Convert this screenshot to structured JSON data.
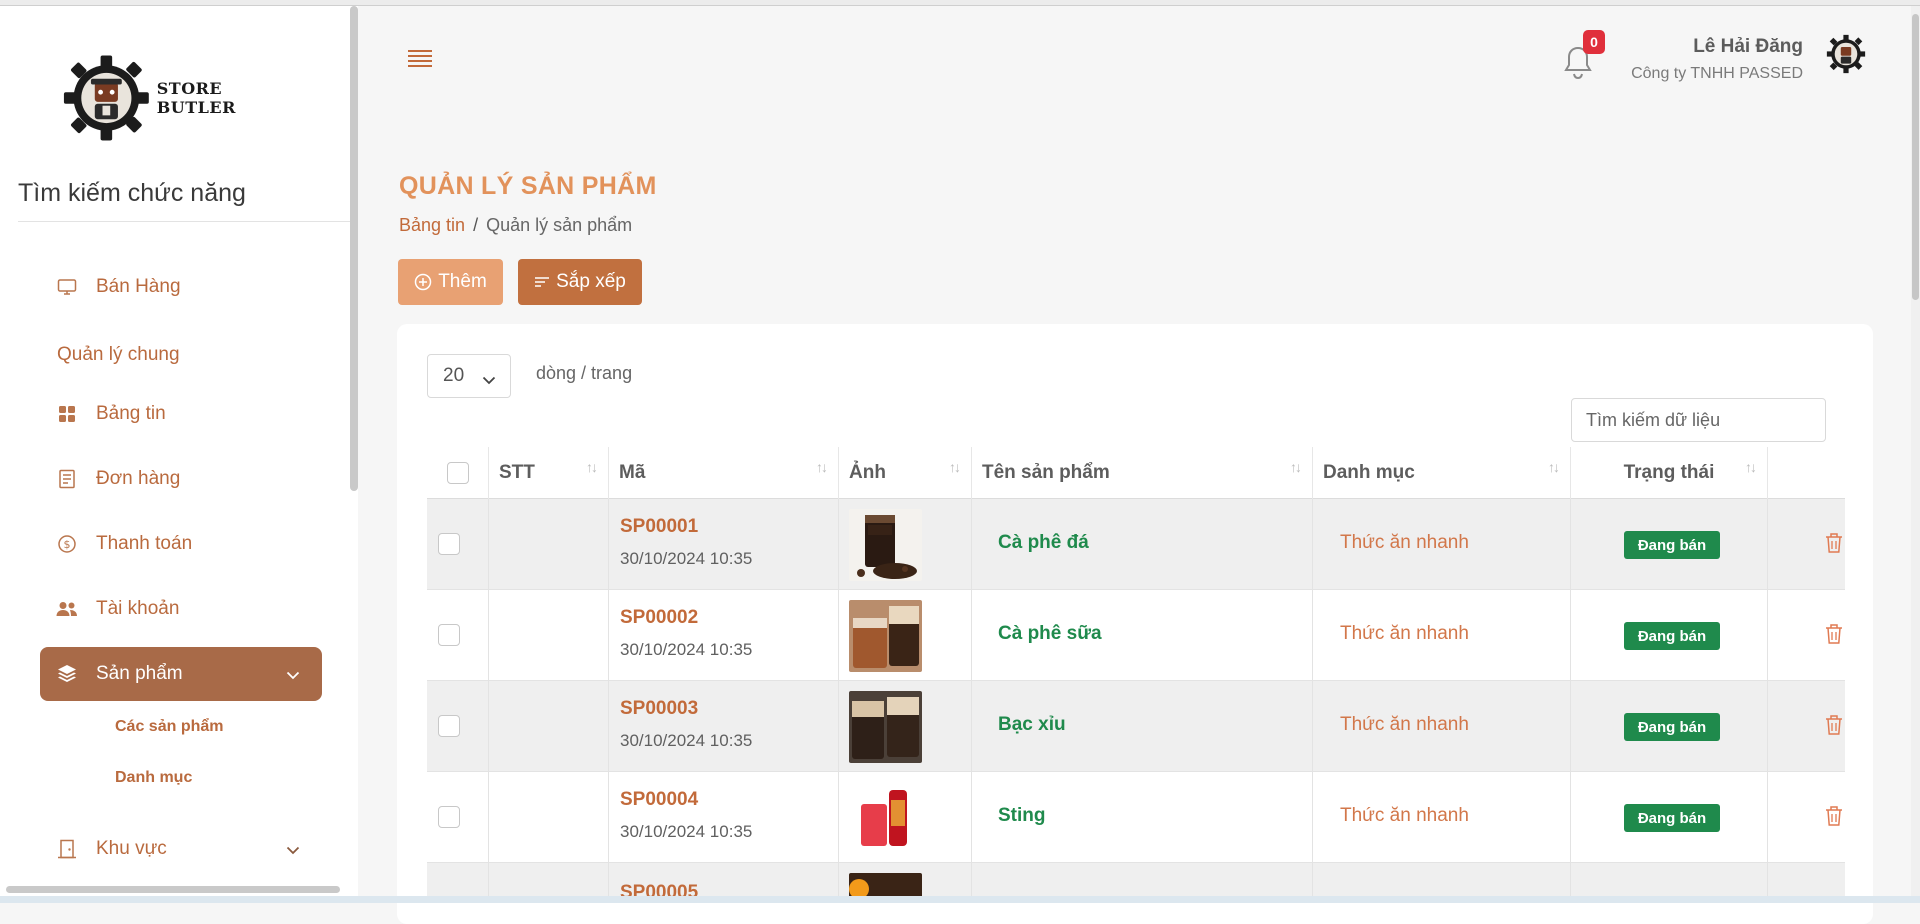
{
  "brand": {
    "name": "STORE BUTLER"
  },
  "sidebar": {
    "search_placeholder": "Tìm kiếm chức năng",
    "sales": {
      "label": "Bán Hàng",
      "icon": "monitor-icon"
    },
    "section_label": "Quản lý chung",
    "items": [
      {
        "label": "Bảng tin",
        "icon": "grid-icon"
      },
      {
        "label": "Đơn hàng",
        "icon": "document-icon"
      },
      {
        "label": "Thanh toán",
        "icon": "coin-icon"
      },
      {
        "label": "Tài khoản",
        "icon": "users-icon"
      },
      {
        "label": "Sản phẩm",
        "icon": "layers-icon",
        "active": true
      },
      {
        "label": "Khu vực",
        "icon": "door-icon"
      }
    ],
    "sub_items": [
      "Các sản phẩm",
      "Danh mục"
    ]
  },
  "header": {
    "notification_count": "0",
    "user_name": "Lê Hải Đăng",
    "company": "Công ty TNHH PASSED"
  },
  "page": {
    "title": "QUẢN LÝ SẢN PHẨM",
    "breadcrumb": {
      "home": "Bảng tin",
      "separator": "/",
      "current": "Quản lý sản phẩm"
    },
    "add_label": "Thêm",
    "sort_label": "Sắp xếp"
  },
  "table": {
    "page_size": "20",
    "rows_per_page_label": "dòng / trang",
    "search_placeholder": "Tìm kiếm dữ liệu",
    "columns": [
      "STT",
      "Mã",
      "Ảnh",
      "Tên sản phẩm",
      "Danh mục",
      "Trạng thái"
    ],
    "rows": [
      {
        "code": "SP00001",
        "date": "30/10/2024 10:35",
        "name": "Cà phê đá",
        "category": "Thức ăn nhanh",
        "status": "Đang bán"
      },
      {
        "code": "SP00002",
        "date": "30/10/2024 10:35",
        "name": "Cà phê sữa",
        "category": "Thức ăn nhanh",
        "status": "Đang bán"
      },
      {
        "code": "SP00003",
        "date": "30/10/2024 10:35",
        "name": "Bạc xỉu",
        "category": "Thức ăn nhanh",
        "status": "Đang bán"
      },
      {
        "code": "SP00004",
        "date": "30/10/2024 10:35",
        "name": "Sting",
        "category": "Thức ăn nhanh",
        "status": "Đang bán"
      },
      {
        "code": "SP00005"
      }
    ]
  },
  "colors": {
    "accent": "#c26a3a",
    "active_menu": "#a86a48",
    "status_green": "#1f8a4c",
    "badge_red": "#e02f3b"
  }
}
